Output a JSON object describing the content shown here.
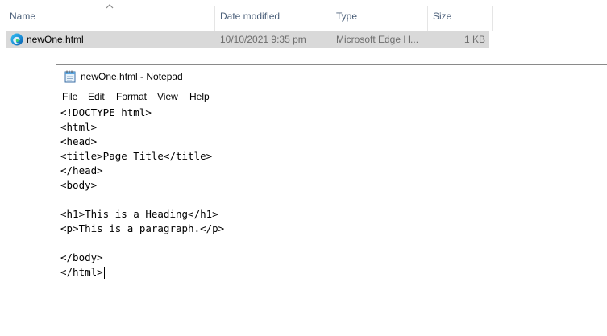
{
  "explorer": {
    "columns": {
      "name": "Name",
      "date_modified": "Date modified",
      "type": "Type",
      "size": "Size"
    },
    "file": {
      "name": "newOne.html",
      "date_modified": "10/10/2021 9:35 pm",
      "type": "Microsoft Edge H...",
      "size": "1 KB",
      "icon": "edge-icon"
    }
  },
  "notepad": {
    "title": "newOne.html - Notepad",
    "icon": "notepad-icon",
    "menu": {
      "file": "File",
      "edit": "Edit",
      "format": "Format",
      "view": "View",
      "help": "Help"
    },
    "lines": [
      "<!DOCTYPE html>",
      "<html>",
      "<head>",
      "<title>Page Title</title>",
      "</head>",
      "<body>",
      "",
      "<h1>This is a Heading</h1>",
      "<p>This is a paragraph.</p>",
      "",
      "</body>",
      "</html>"
    ]
  },
  "colors": {
    "selection": "#d9d9d9",
    "header_text": "#4c607a",
    "meta_text": "#6d6d6d"
  }
}
